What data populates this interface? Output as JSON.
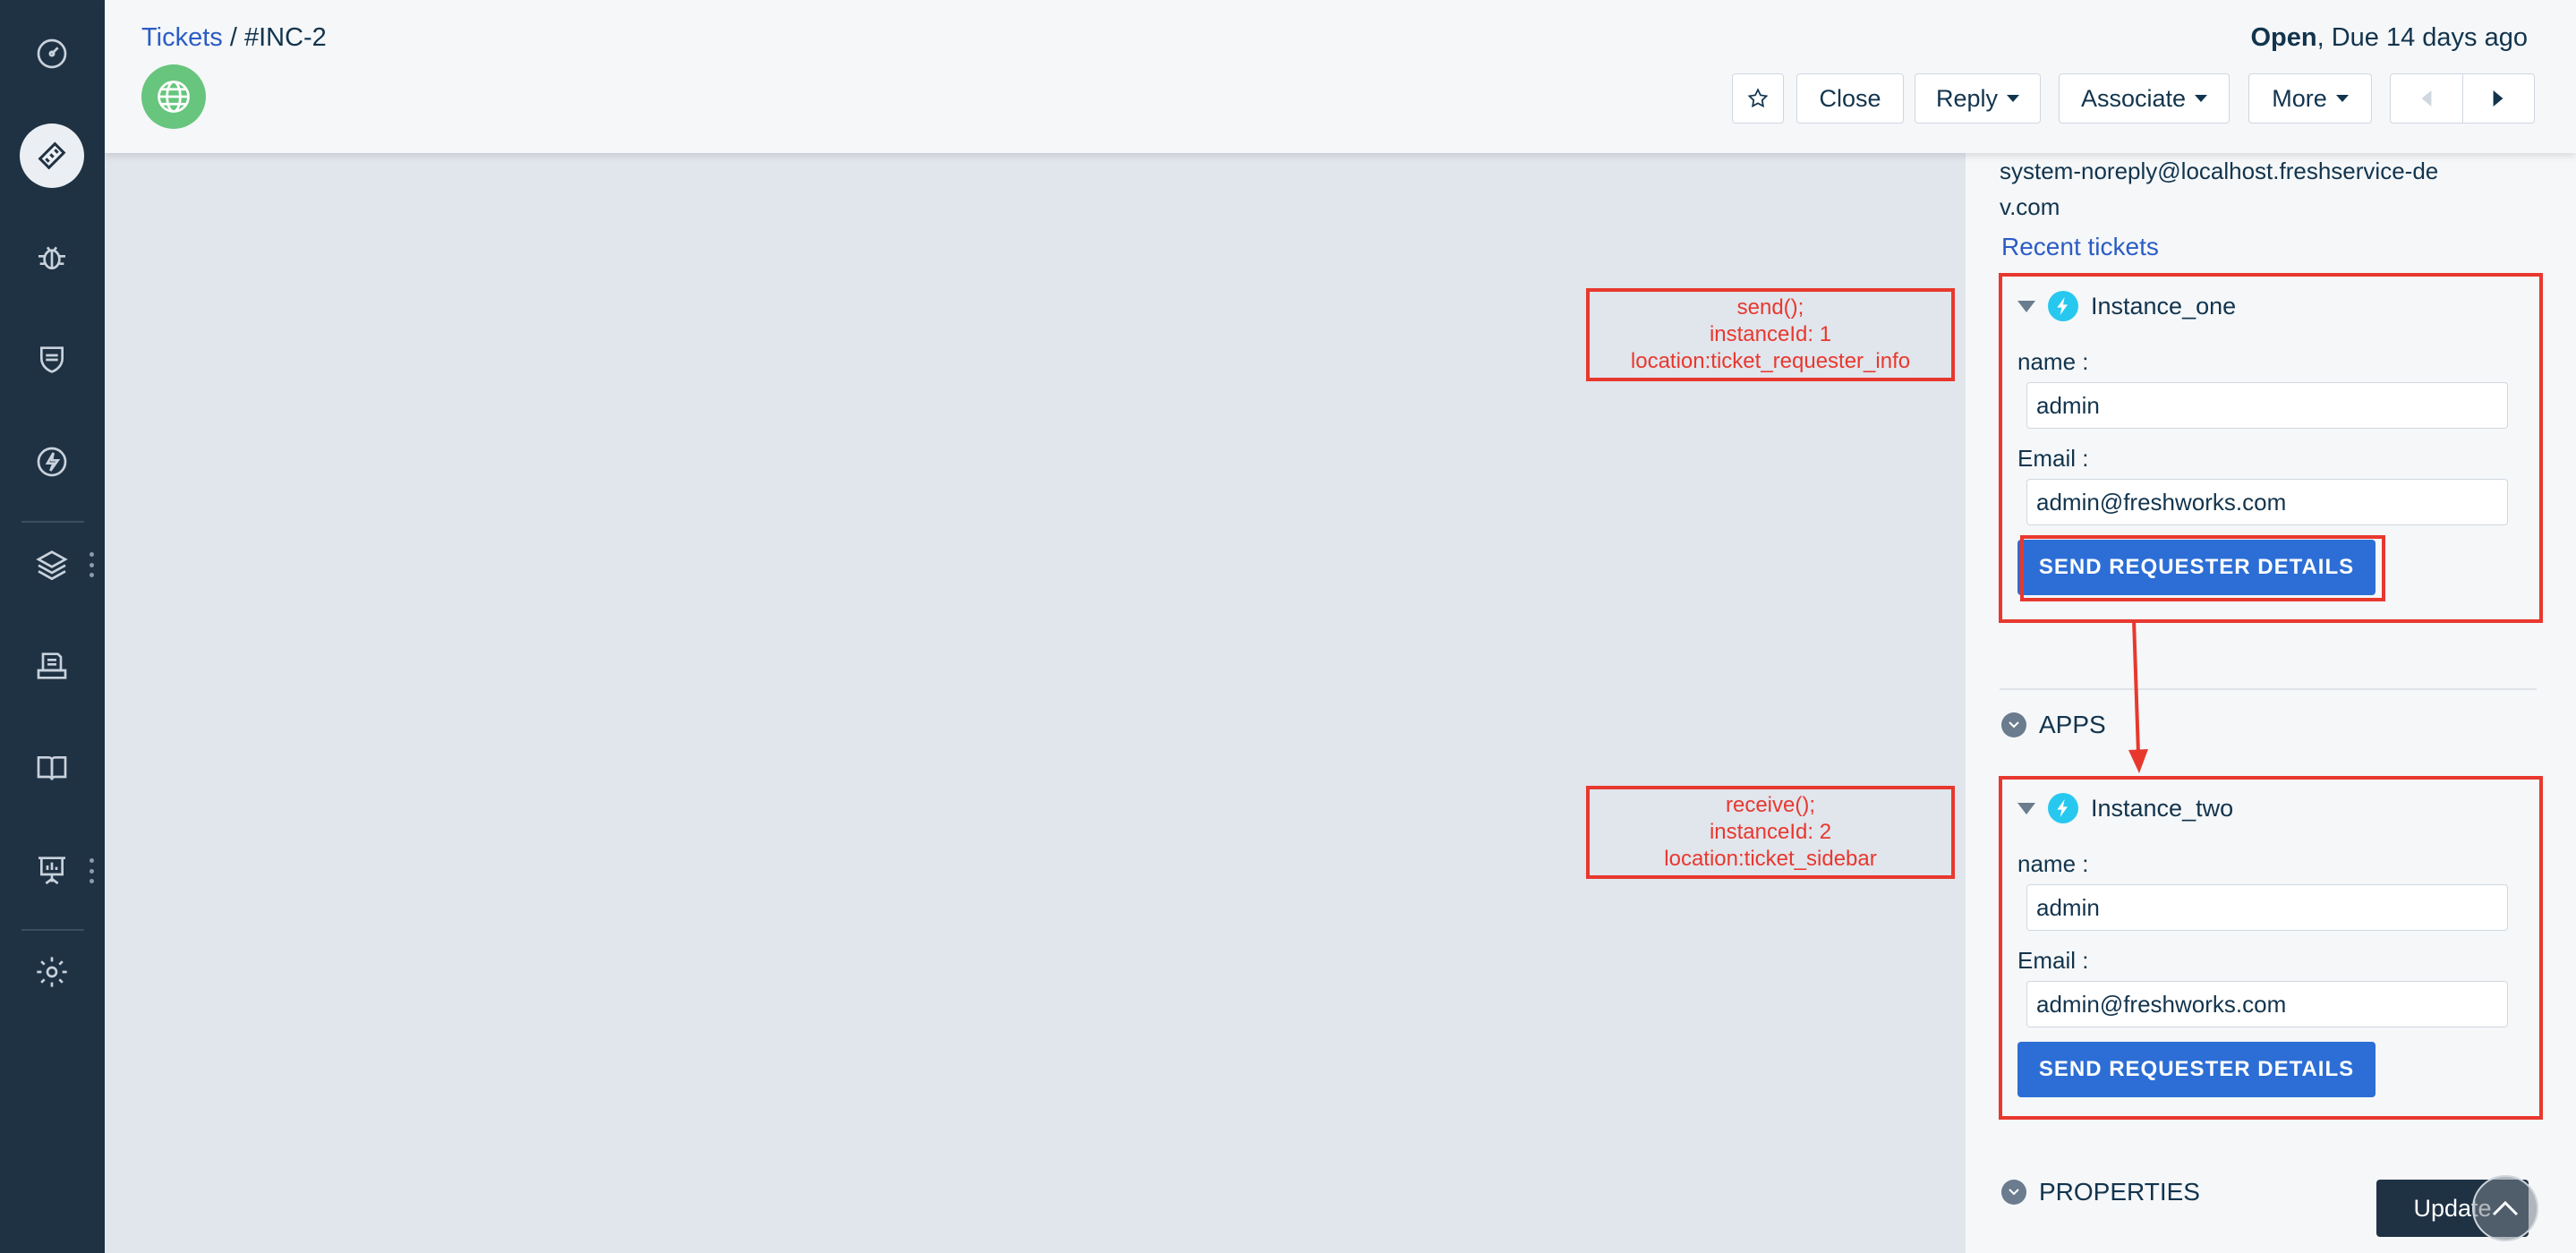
{
  "sidebar": {
    "items": [
      {
        "name": "dashboard",
        "icon": "gauge-icon"
      },
      {
        "name": "tickets",
        "icon": "ticket-icon"
      },
      {
        "name": "problems",
        "icon": "bug-icon"
      },
      {
        "name": "changes",
        "icon": "shield-icon"
      },
      {
        "name": "releases",
        "icon": "bolt-icon"
      },
      {
        "name": "assets",
        "icon": "layers-icon"
      },
      {
        "name": "contracts",
        "icon": "inbox-icon"
      },
      {
        "name": "solutions",
        "icon": "book-icon"
      },
      {
        "name": "analytics",
        "icon": "presentation-icon"
      },
      {
        "name": "admin",
        "icon": "gear-icon"
      }
    ]
  },
  "header": {
    "breadcrumb_link": "Tickets",
    "breadcrumb_sep": " / ",
    "ticket_id": "#INC-2",
    "status": "Open",
    "due": ", Due 14 days ago",
    "close_label": "Close",
    "reply_label": "Reply",
    "associate_label": "Associate",
    "more_label": "More"
  },
  "requester": {
    "email_line1": "system-noreply@localhost.freshservice-de",
    "email_line2": "v.com",
    "recent_tickets": "Recent tickets"
  },
  "instance_one": {
    "title": "Instance_one",
    "name_label": "name :",
    "name_value": "admin",
    "email_label": "Email :",
    "email_value": "admin@freshworks.com",
    "button_label": "SEND REQUESTER DETAILS"
  },
  "apps_section": "APPS",
  "instance_two": {
    "title": "Instance_two",
    "name_label": "name :",
    "name_value": "admin",
    "email_label": "Email :",
    "email_value": "admin@freshworks.com",
    "button_label": "SEND REQUESTER DETAILS"
  },
  "properties_section": "PROPERTIES",
  "update_label": "Update",
  "annotations": {
    "send": {
      "line1": "send();",
      "line2": "instanceId: 1",
      "line3": "location:ticket_requester_info"
    },
    "receive": {
      "line1": "receive();",
      "line2": "instanceId: 2",
      "line3": "location:ticket_sidebar"
    }
  },
  "colors": {
    "sidebar_bg": "#1f3244",
    "link": "#2c5cc5",
    "primary_button": "#2c6ed5",
    "annotation_red": "#e8382e",
    "app_icon": "#27c8ef",
    "globe": "#67c57d"
  }
}
